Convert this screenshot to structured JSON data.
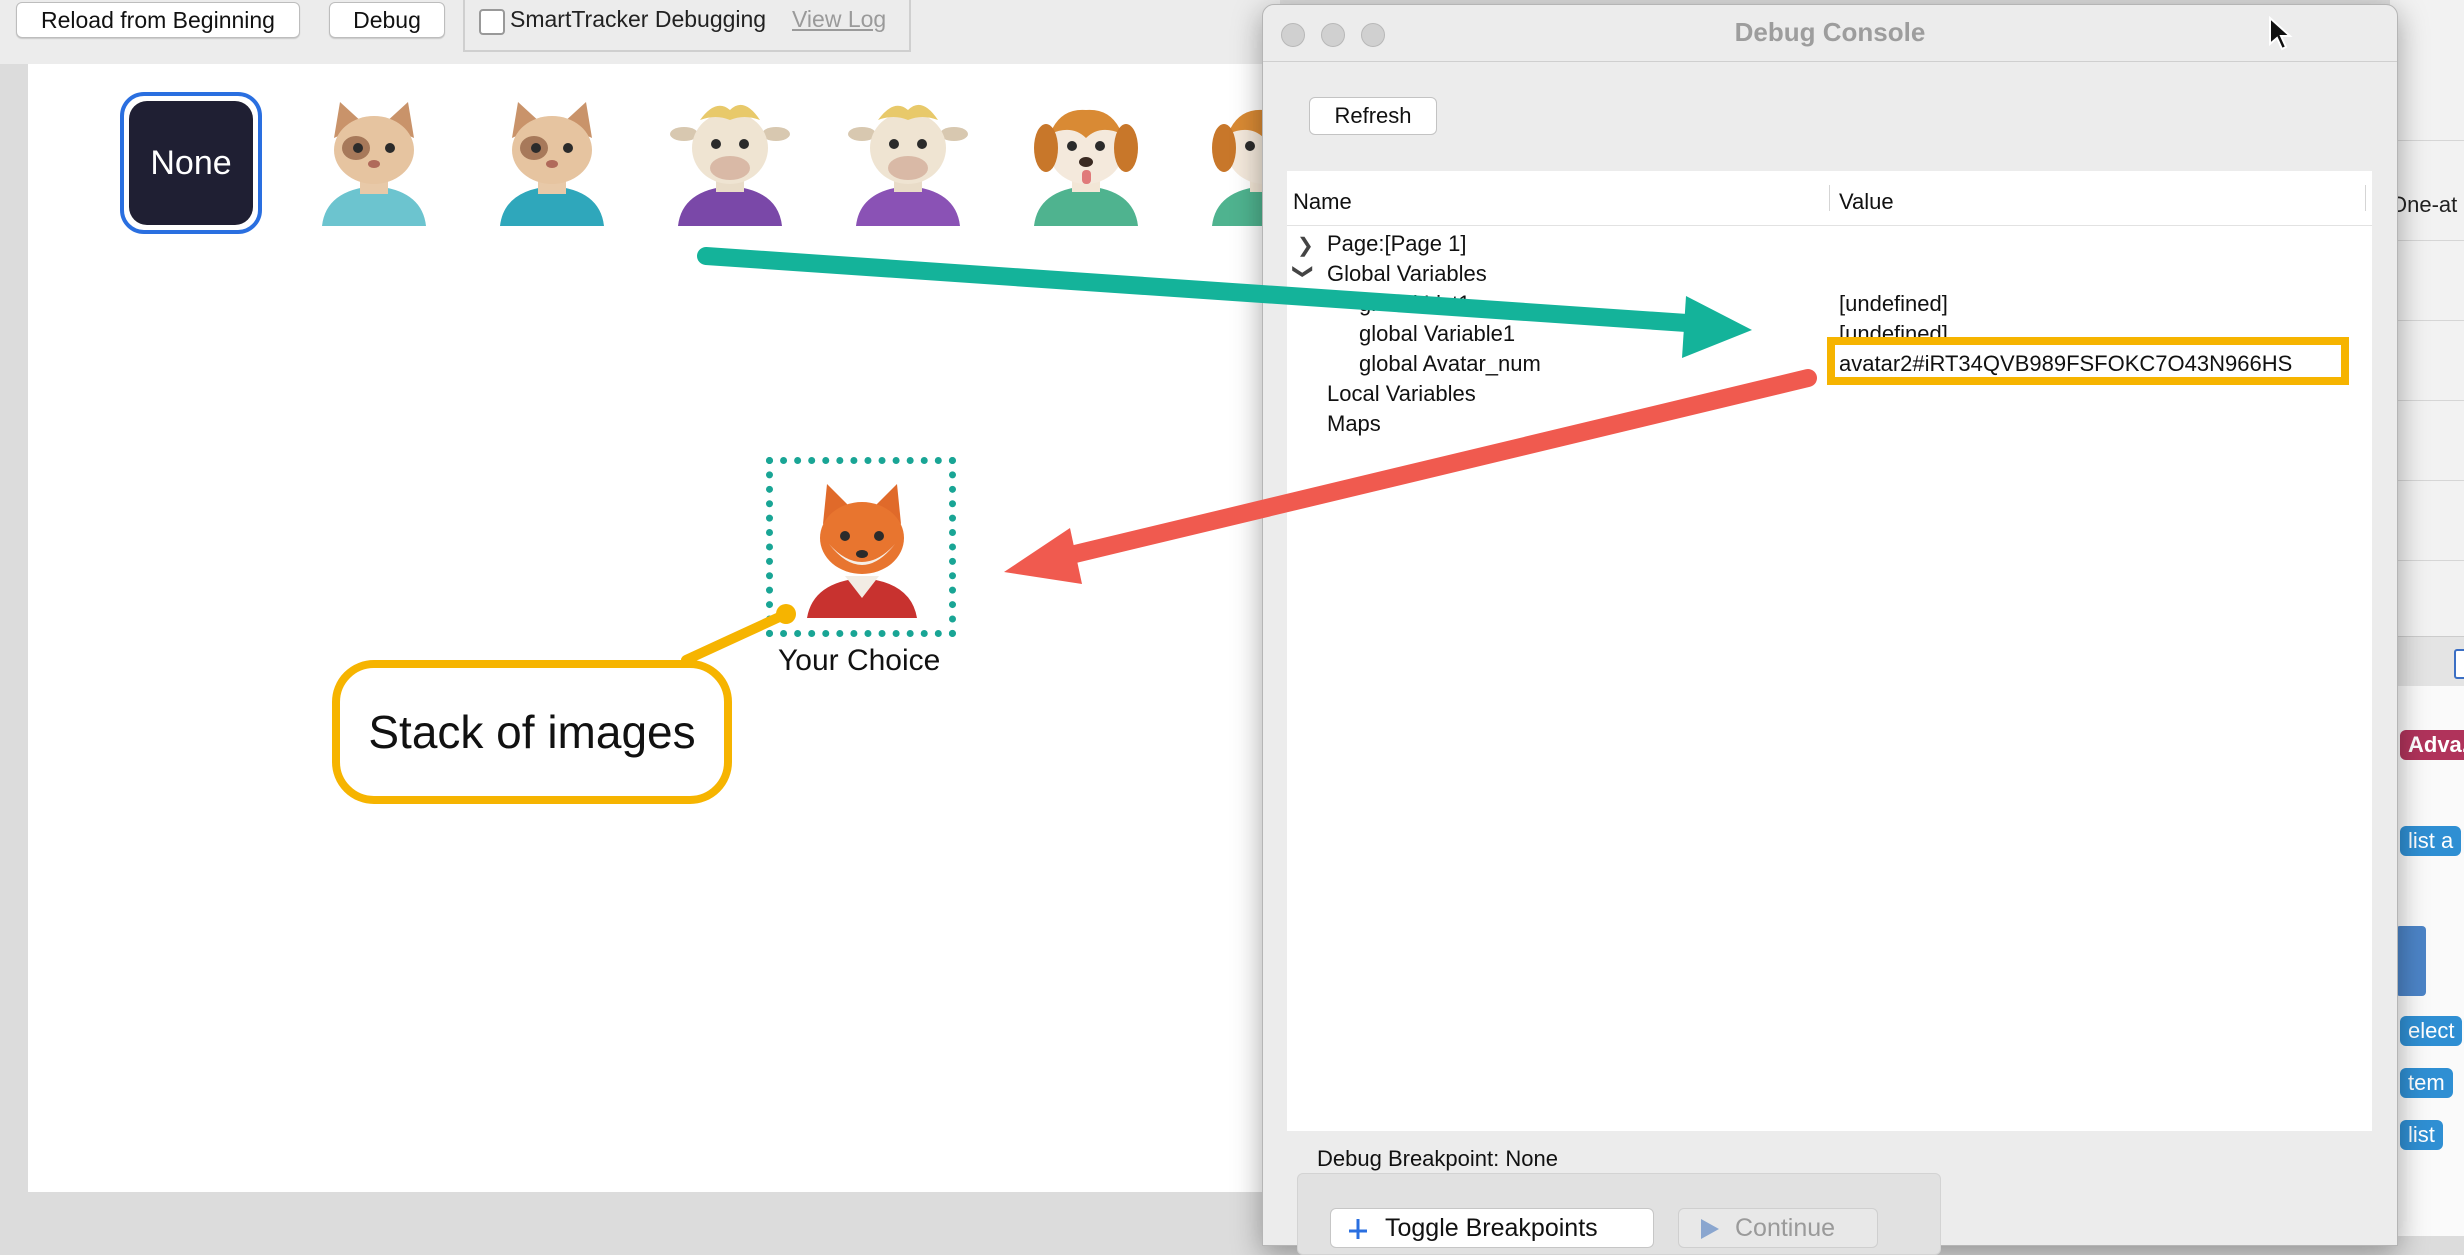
{
  "toolbar": {
    "reload_label": "Reload from Beginning",
    "debug_label": "Debug",
    "smarttracker_label": "SmartTracker Debugging",
    "view_log_label": "View Log"
  },
  "canvas": {
    "none_label": "None",
    "choice_label": "Your Choice",
    "callout_text": "Stack of images"
  },
  "console": {
    "title": "Debug Console",
    "refresh_label": "Refresh",
    "columns": {
      "name": "Name",
      "value": "Value"
    },
    "rows": {
      "page": "Page:[Page 1]",
      "globals": "Global Variables",
      "list1": "global List1",
      "list1_value": "[undefined]",
      "var1": "global Variable1",
      "var1_value": "[undefined]",
      "avatar": "global Avatar_num",
      "avatar_value": "avatar2#iRT34QVB989FSFOKC7O43N966HS",
      "locals": "Local Variables",
      "maps": "Maps"
    },
    "breakpoint_label": "Debug Breakpoint: None",
    "toggle_label": "Toggle Breakpoints",
    "continue_label": "Continue"
  },
  "background_app": {
    "one_at": "One-at",
    "adva": "Adva...",
    "list_a": "list a",
    "select": "elect",
    "item": "tem",
    "list": "list"
  },
  "colors": {
    "accent_blue": "#2a6fe0",
    "teal_arrow": "#14b39a",
    "red_arrow": "#f05a4f",
    "callout_yellow": "#f6b400"
  }
}
